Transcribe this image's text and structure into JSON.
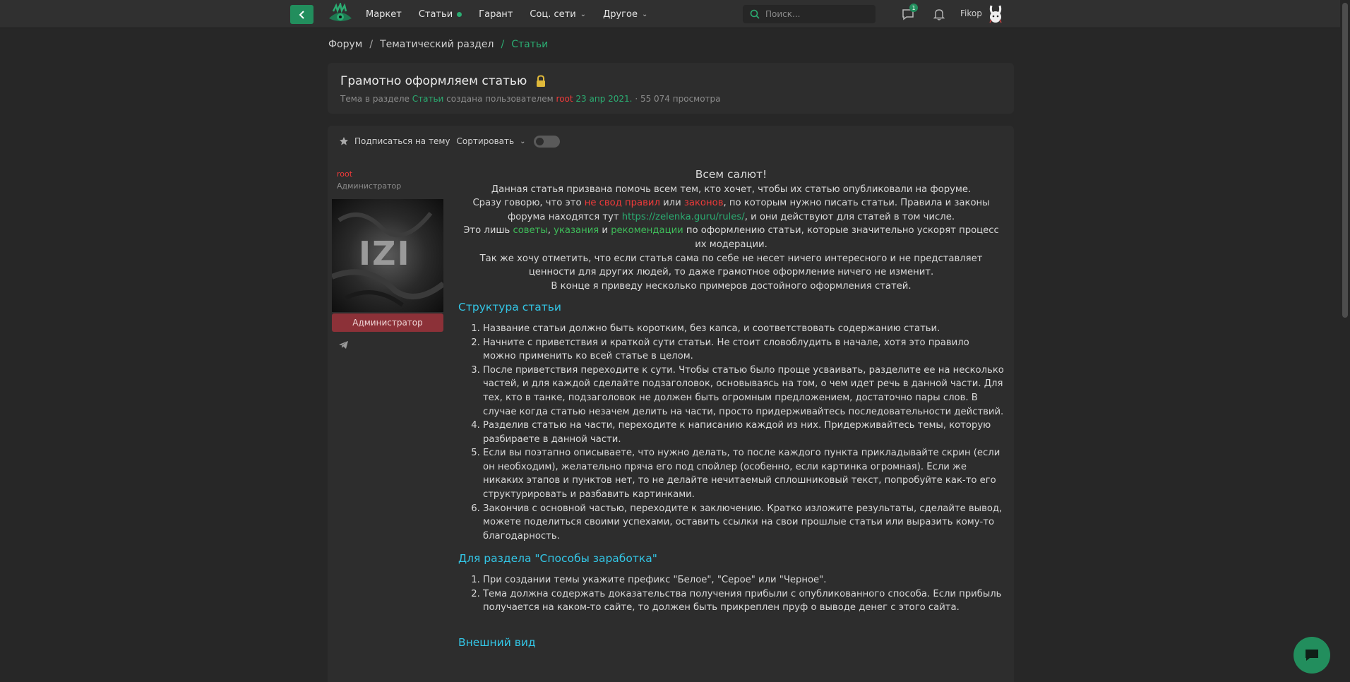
{
  "nav": {
    "items": [
      {
        "label": "Маркет"
      },
      {
        "label": "Статьи"
      },
      {
        "label": "Гарант"
      },
      {
        "label": "Соц. сети"
      },
      {
        "label": "Другое"
      }
    ],
    "search_placeholder": "Поиск...",
    "messages_badge": "1",
    "username": "Fikop"
  },
  "breadcrumb": [
    "Форум",
    "Тематический раздел",
    "Статьи"
  ],
  "thread": {
    "title": "Грамотно оформляем статью",
    "meta_prefix": "Тема в разделе",
    "meta_section": "Статьи",
    "meta_mid": "создана пользователем",
    "meta_author": "root",
    "meta_date": "23 апр 2021.",
    "meta_views": "· 55 074 просмотра"
  },
  "toolbar": {
    "subscribe": "Подписаться на тему",
    "sort": "Сортировать"
  },
  "author": {
    "name": "root",
    "role": "Администратор",
    "badge": "Администратор",
    "avatar_text": "IZI"
  },
  "article": {
    "greeting": "Всем салют!",
    "intro1": "Данная статья призвана помочь всем тем, кто хочет, чтобы их статью опубликовали на форуме.",
    "intro2_a": "Сразу говорю, что это ",
    "intro2_link1": "не свод правил",
    "intro2_b": " или ",
    "intro2_link2": "законов",
    "intro2_c": ", по которым нужно писать статьи. Правила и законы форума находятся тут ",
    "intro2_url": "https://zelenka.guru/rules/",
    "intro2_d": ", и они действуют для статей в том числе.",
    "intro3_a": "Это лишь ",
    "intro3_w1": "советы",
    "intro3_b": ", ",
    "intro3_w2": "указания",
    "intro3_c": " и ",
    "intro3_w3": "рекомендации",
    "intro3_d": " по оформлению статьи, которые значительно ускорят процесс их модерации.",
    "intro4": "Так же хочу отметить, что если статья сама по себе не несет ничего интересного и не представляет ценности для других людей, то даже грамотное оформление ничего не изменит.",
    "intro5": "В конце я приведу несколько примеров достойного оформления статей.",
    "section1_title": "Структура статьи",
    "section1_items": [
      "Название статьи должно быть коротким, без капса, и соответствовать содержанию статьи.",
      "Начните с приветствия и краткой сути статьи. Не стоит словоблудить в начале, хотя это правило можно применить ко всей статье в целом.",
      "После приветствия переходите к сути. Чтобы статью было проще усваивать, разделите ее на несколько частей, и для каждой сделайте подзаголовок, основываясь на том, о чем идет речь в данной части. Для тех, кто в танке, подзаголовок не должен быть огромным предложением, достаточно пары слов. В случае когда статью незачем делить на части, просто придерживайтесь последовательности действий.",
      "Разделив статью на части, переходите к написанию каждой из них. Придерживайтесь темы, которую разбираете в данной части.",
      "Если вы поэтапно описываете, что нужно делать, то после каждого пункта прикладывайте скрин (если он необходим), желательно пряча его под спойлер (особенно, если картинка огромная). Если же никаких этапов и пунктов нет, то не делайте нечитаемый сплошниковый текст, попробуйте как-то его структурировать и разбавить картинками.",
      "Закончив с основной частью, переходите к заключению. Кратко изложите результаты, сделайте вывод, можете поделиться своими успехами, оставить ссылки на свои прошлые статьи или выразить кому-то благодарность."
    ],
    "section2_title": "Для раздела \"Способы заработка\"",
    "section2_items": [
      "При создании темы укажите префикс \"Белое\", \"Серое\" или \"Черное\".",
      "Тема должна содержать доказательства получения прибыли с опубликованного способа. Если прибыль получается на каком-то сайте, то должен быть прикреплен пруф о выводе денег с этого сайта."
    ],
    "section3_title": "Внешний вид"
  },
  "colors": {
    "accent": "#228e5d",
    "accent_text": "#2bad72",
    "author_red": "#f03a3a",
    "heading_cyan": "#33c6e6",
    "admin_badge": "#8c3138"
  }
}
